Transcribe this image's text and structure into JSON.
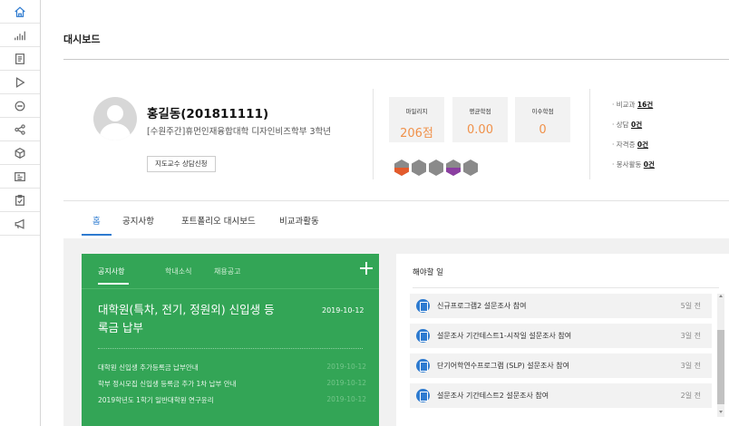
{
  "sidebar": {
    "icons": [
      "home-icon",
      "bar-chart-icon",
      "document-icon",
      "play-icon",
      "chat-icon",
      "share-icon",
      "cube-icon",
      "id-card-icon",
      "clipboard-icon",
      "megaphone-icon"
    ]
  },
  "page": {
    "title": "대시보드"
  },
  "profile": {
    "name": "홍길동(201811111)",
    "department": "[수원주간]휴먼인재융합대학 디자인비즈학부 3학년",
    "consult_button": "지도교수 상담신청"
  },
  "stats": [
    {
      "label": "마일리지",
      "value": "206점"
    },
    {
      "label": "평균학점",
      "value": "0.00"
    },
    {
      "label": "이수학점",
      "value": "0"
    }
  ],
  "badges": [
    {
      "color": "#e35b2c",
      "half": true
    },
    {
      "color": "#8a8a8a",
      "half": true
    },
    {
      "color": "#8a8a8a",
      "half": false
    },
    {
      "color": "#8b3fa1",
      "half": true
    },
    {
      "color": "#8a8a8a",
      "half": false
    }
  ],
  "side_stats": [
    {
      "label": "비교과",
      "value": "16건"
    },
    {
      "label": "상담",
      "value": "0건"
    },
    {
      "label": "자격증",
      "value": "0건"
    },
    {
      "label": "봉사활동",
      "value": "0건"
    }
  ],
  "tabs": [
    "홈",
    "공지사항",
    "포트폴리오 대시보드",
    "비교과활동"
  ],
  "notice_panel": {
    "tabs": [
      "공지사항",
      "학내소식",
      "채용공고"
    ],
    "headline": "대학원(특차, 전기, 정원외) 신입생 등록금 납부",
    "headline_date": "2019-10-12",
    "items": [
      {
        "text": "대학원 신입생 추가등록금 납부안내",
        "date": "2019-10-12"
      },
      {
        "text": "학부 정시모집 신입생 등록금 추가 1차 납부 안내",
        "date": "2019-10-12"
      },
      {
        "text": "2019학년도 1학기 일반대학원 연구윤리",
        "date": "2019-10-12"
      }
    ],
    "accent": "#33a556"
  },
  "todo": {
    "title": "해야할 일",
    "items": [
      {
        "text": "신규프로그램2 설문조사 참여",
        "time": "5일 전"
      },
      {
        "text": "설문조사 기간테스트1-시작일 설문조사 참여",
        "time": "3일 전"
      },
      {
        "text": "단기어학연수프로그램 (SLP) 설문조사 참여",
        "time": "3일 전"
      },
      {
        "text": "설문조사 기간테스트2 설문조사 참여",
        "time": "2일 전"
      }
    ]
  }
}
